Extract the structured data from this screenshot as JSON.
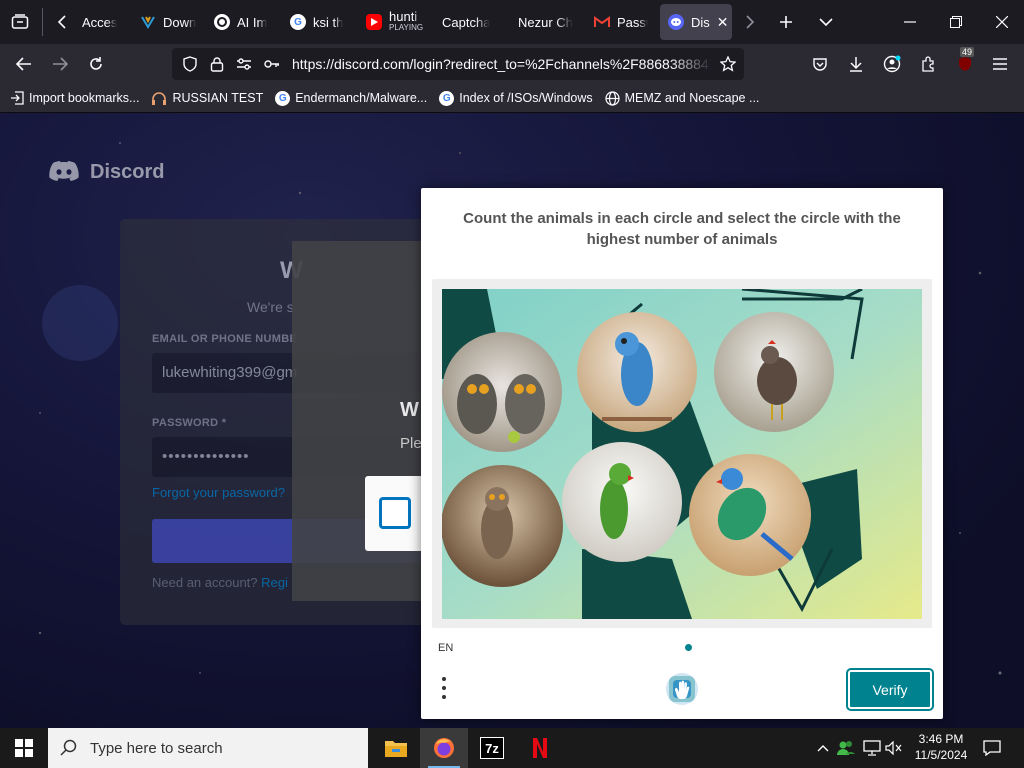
{
  "browser": {
    "tabs": [
      {
        "label": "Acces",
        "icon": "doc-icon"
      },
      {
        "label": "Down",
        "icon": "vs-icon"
      },
      {
        "label": "AI Im",
        "icon": "ai-icon"
      },
      {
        "label": "ksi th",
        "icon": "google-icon"
      },
      {
        "label": "hunti",
        "sublabel": "PLAYING",
        "icon": "youtube-icon"
      },
      {
        "label": "Captcha",
        "icon": ""
      },
      {
        "label": "Nezur Ch",
        "icon": ""
      },
      {
        "label": "Passw",
        "icon": "gmail-icon"
      },
      {
        "label": "Dis",
        "icon": "discord-icon",
        "active": true
      }
    ],
    "url": "https://discord.com/login?redirect_to=%2Fchannels%2F8868388847",
    "extension_badge": "49",
    "bookmarks": [
      {
        "label": "Import bookmarks...",
        "icon": "import-icon"
      },
      {
        "label": "RUSSIAN TEST",
        "icon": "headphones-icon"
      },
      {
        "label": "Endermanch/Malware...",
        "icon": "google-icon"
      },
      {
        "label": "Index of /ISOs/Windows",
        "icon": "google-icon"
      },
      {
        "label": "MEMZ and Noescape ...",
        "icon": "globe-icon"
      }
    ]
  },
  "discord": {
    "brand": "Discord",
    "welcome_initial": "W",
    "subtitle_partial": "We're s",
    "email_label": "EMAIL OR PHONE NUMBE",
    "email_value": "lukewhiting399@gm",
    "password_label": "PASSWORD *",
    "password_value": "••••••••••••••",
    "forgot_link": "Forgot your password?",
    "register_prefix": "Need an account?",
    "register_link": "Regi",
    "overlay_heading": "W",
    "overlay_text": "Ple"
  },
  "captcha": {
    "prompt": "Count the animals in each circle and select the circle with the highest number of animals",
    "language": "EN",
    "verify_label": "Verify",
    "circles": [
      {
        "animal": "owl",
        "count": 2
      },
      {
        "animal": "parrot",
        "count": 1
      },
      {
        "animal": "chicken",
        "count": 1
      },
      {
        "animal": "owl",
        "count": 1
      },
      {
        "animal": "parrot",
        "count": 1
      },
      {
        "animal": "parrot",
        "count": 1
      }
    ]
  },
  "taskbar": {
    "search_placeholder": "Type here to search",
    "time": "3:46 PM",
    "date": "11/5/2024",
    "apps": [
      "file-explorer-icon",
      "firefox-icon",
      "7zip-icon",
      "netflix-icon"
    ]
  }
}
